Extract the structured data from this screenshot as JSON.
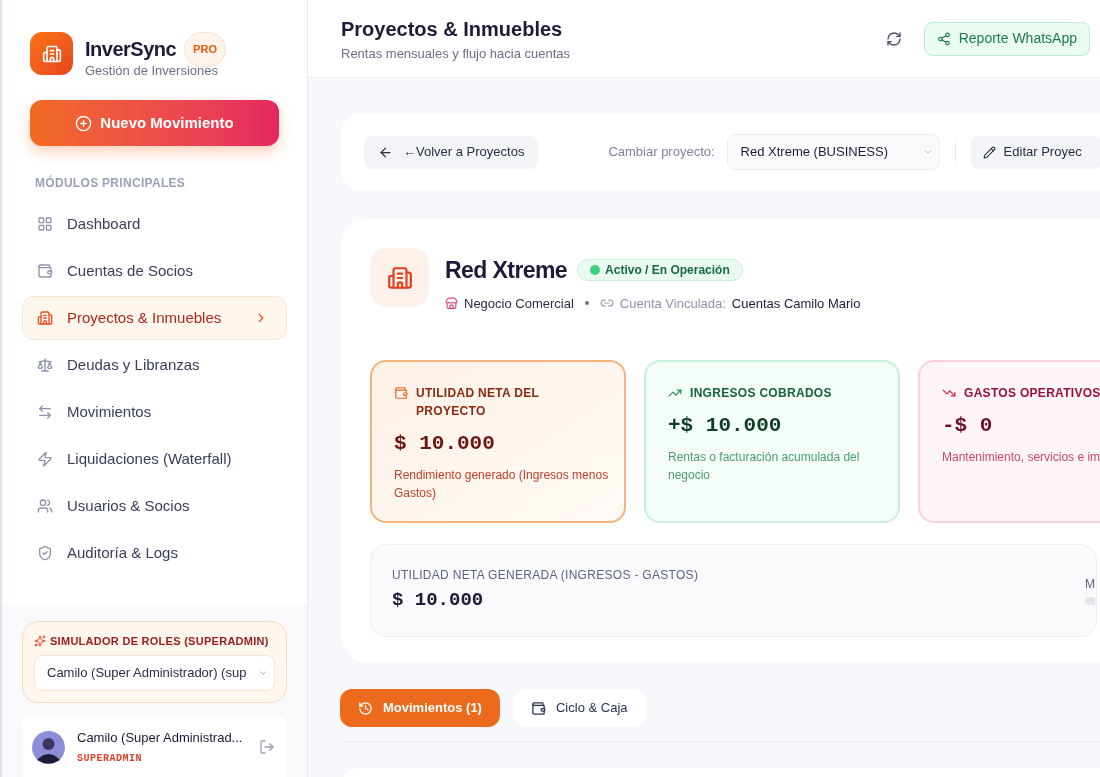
{
  "brand": {
    "name": "InverSync",
    "badge": "PRO",
    "subtitle": "Gestión de Inversiones"
  },
  "new_button": "Nuevo Movimiento",
  "sidebar": {
    "section": "MÓDULOS PRINCIPALES",
    "items": [
      {
        "label": "Dashboard",
        "selected": false
      },
      {
        "label": "Cuentas de Socios",
        "selected": false
      },
      {
        "label": "Proyectos & Inmuebles",
        "selected": true
      },
      {
        "label": "Deudas y Libranzas",
        "selected": false
      },
      {
        "label": "Movimientos",
        "selected": false
      },
      {
        "label": "Liquidaciones (Waterfall)",
        "selected": false
      },
      {
        "label": "Usuarios & Socios",
        "selected": false
      },
      {
        "label": "Auditoría & Logs",
        "selected": false
      }
    ]
  },
  "role_simulator": {
    "title": "SIMULADOR DE ROLES (SUPERADMIN)",
    "value": "Camilo (Super Administrador) (sup"
  },
  "user": {
    "name": "Camilo (Super Administrad...",
    "role": "SUPERADMIN"
  },
  "header": {
    "title": "Proyectos & Inmuebles",
    "subtitle": "Rentas mensuales y flujo hacia cuentas",
    "report_button": "Reporte WhatsApp"
  },
  "toolbar": {
    "back_button": "←Volver a Proyectos",
    "switch_label": "Cambiar proyecto:",
    "project_select": "Red Xtreme (BUSINESS)",
    "edit_button": "Editar Proyec"
  },
  "project": {
    "name": "Red Xtreme",
    "status": "Activo / En Operación",
    "type": "Negocio Comercial",
    "linked_label": "Cuenta Vinculada:",
    "linked_account": "Cuentas Camilo Mario"
  },
  "stats": [
    {
      "kind": "net",
      "label": "UTILIDAD NETA DEL PROYECTO",
      "value": "$ 10.000",
      "note": "Rendimiento generado (Ingresos menos Gastos)"
    },
    {
      "kind": "income",
      "label": "INGRESOS COBRADOS",
      "value": "+$ 10.000",
      "note": "Rentas o facturación acumulada del negocio"
    },
    {
      "kind": "expense",
      "label": "GASTOS OPERATIVOS",
      "value": "-$ 0",
      "note": "Mantenimiento, servicios e im"
    }
  ],
  "summary": {
    "label": "UTILIDAD NETA GENERADA (INGRESOS - GASTOS)",
    "value": "$ 10.000",
    "column_2": "M"
  },
  "tabs": [
    {
      "label": "Movimientos (1)",
      "selected": true
    },
    {
      "label": "Ciclo & Caja",
      "selected": false
    }
  ]
}
